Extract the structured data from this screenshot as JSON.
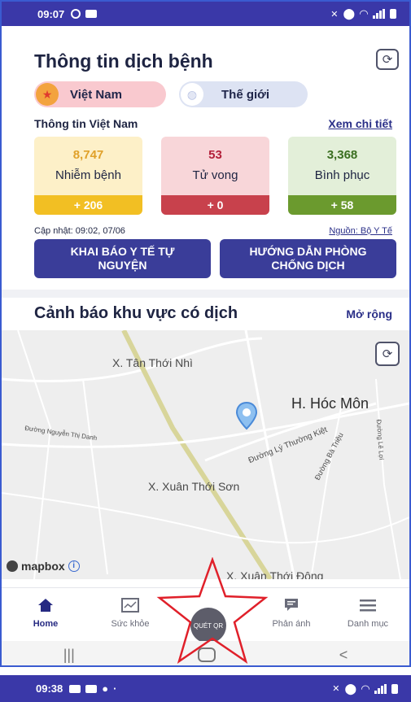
{
  "status_bar": {
    "time": "09:07"
  },
  "header": {
    "title": "Thông tin dịch bệnh"
  },
  "segments": {
    "vietnam": "Việt Nam",
    "world": "Thế giới"
  },
  "vn_info": {
    "title": "Thông tin Việt Nam",
    "detail_link": "Xem chi tiết"
  },
  "stats": [
    {
      "value": "8,747",
      "label": "Nhiễm bệnh",
      "delta": "+ 206"
    },
    {
      "value": "53",
      "label": "Tử vong",
      "delta": "+ 0"
    },
    {
      "value": "3,368",
      "label": "Bình phục",
      "delta": "+ 58"
    }
  ],
  "updated": "Cập nhật: 09:02, 07/06",
  "source": "Nguồn: Bộ Y Tế",
  "actions": {
    "declare": "KHAI BÁO Y TẾ TỰ NGUYỆN",
    "guide": "HƯỚNG DẪN PHÒNG CHỐNG DỊCH"
  },
  "alert": {
    "title": "Cảnh báo khu vực có dịch",
    "expand": "Mở rộng"
  },
  "map": {
    "labels": {
      "tan_thoi_nhi": "X. Tân Thới Nhì",
      "hoc_mon": "H. Hóc Môn",
      "xuan_thoi_son": "X. Xuân Thới Sơn",
      "xuan_thoi_dong": "X. Xuân Thới Đông"
    },
    "roads": {
      "ly_thuong_kiet": "Đường Lý Thường Kiệt",
      "nguyen_thi_danh": "Đường Nguyễn Thị Danh",
      "ba_trieu": "Đường Bà Triệu",
      "le_loi": "Đường Lê Lợi"
    },
    "attribution": "mapbox"
  },
  "bottom_nav": {
    "home": "Home",
    "health": "Sức khỏe",
    "qr": "QUÉT QR",
    "report": "Phản ánh",
    "menu": "Danh mục"
  },
  "status_bar_2": {
    "time": "09:38"
  }
}
